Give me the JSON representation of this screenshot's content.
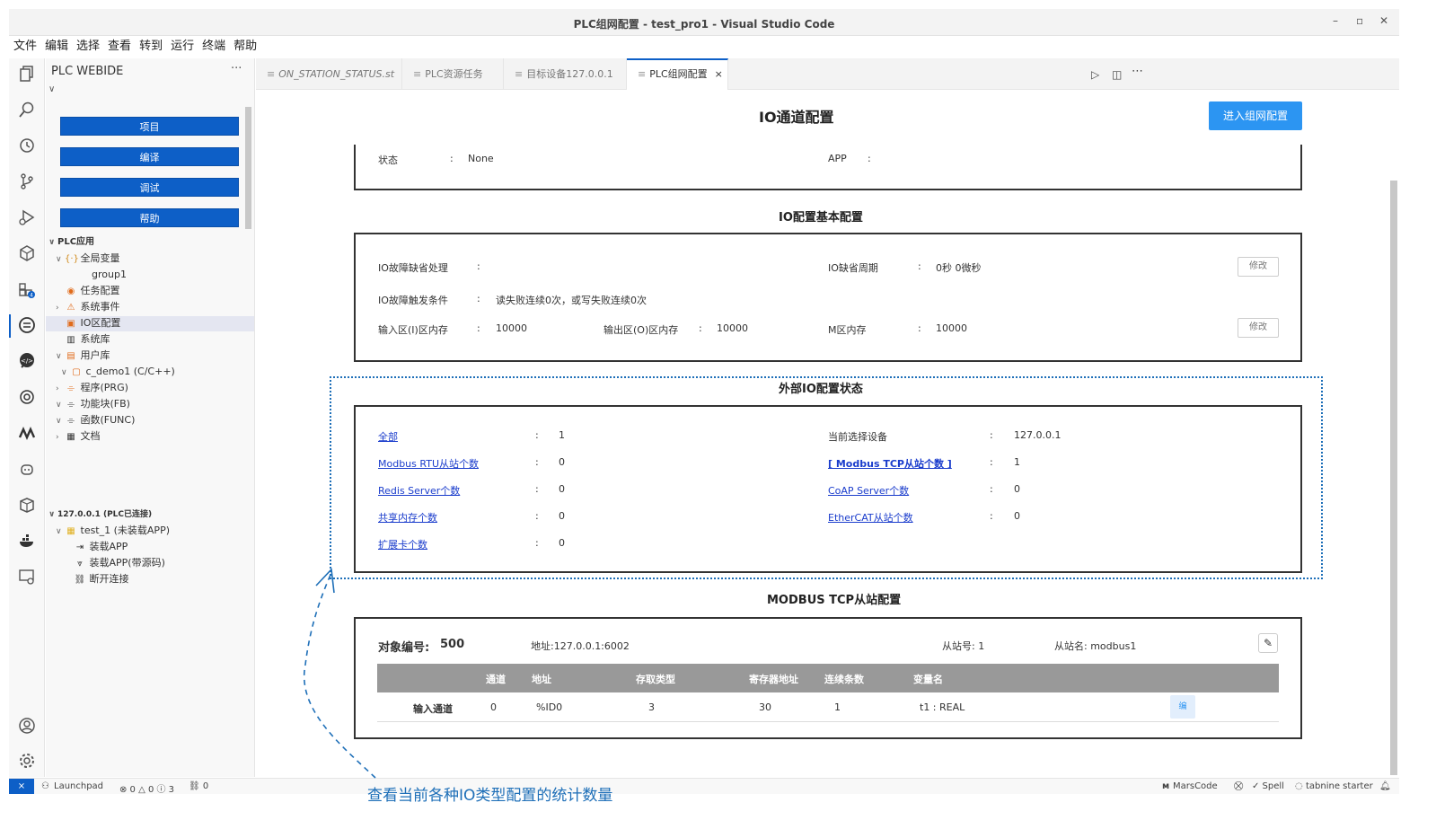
{
  "window": {
    "title": "PLC组网配置 - test_pro1 - Visual Studio Code"
  },
  "menu": [
    "文件",
    "编辑",
    "选择",
    "查看",
    "转到",
    "运行",
    "终端",
    "帮助"
  ],
  "sidebar": {
    "title": "PLC WEBIDE",
    "more": "···",
    "buttons": [
      "项目",
      "编译",
      "调试",
      "帮助"
    ],
    "tree": {
      "plc_app": "PLC应用",
      "global_vars": "全局变量",
      "group1": "group1",
      "task_config": "任务配置",
      "sys_events": "系统事件",
      "io_config": "IO区配置",
      "sys_lib": "系统库",
      "user_lib": "用户库",
      "c_demo": "c_demo1 (C/C++)",
      "prg": "程序(PRG)",
      "fb": "功能块(FB)",
      "func": "函数(FUNC)",
      "docs": "文档",
      "conn": "127.0.0.1 (PLC已连接)",
      "test1": "test_1 (未装载APP)",
      "load_app": "装载APP",
      "load_app_src": "装载APP(带源码)",
      "disconnect": "断开连接"
    }
  },
  "tabs": [
    {
      "label": "ON_STATION_STATUS.st"
    },
    {
      "label": "PLC资源任务"
    },
    {
      "label": "目标设备127.0.0.1"
    },
    {
      "label": "PLC组网配置",
      "close": "×"
    }
  ],
  "editor": {
    "title": "IO通道配置",
    "enter_button": "进入组网配置",
    "status_row": {
      "state_label": "状态",
      "colon": ":",
      "state_value": "None",
      "app_label": "APP",
      "app_colon": ":"
    },
    "basic": {
      "title": "IO配置基本配置",
      "fault_default_label": "IO故障缺省处理",
      "default_period_label": "IO缺省周期",
      "default_period_value": "0秒 0微秒",
      "modify": "修改",
      "fault_trigger_label": "IO故障触发条件",
      "fault_trigger_value": "读失败连续0次，或写失败连续0次",
      "input_mem_label": "输入区(I)区内存",
      "input_mem_value": "10000",
      "output_mem_label": "输出区(O)区内存",
      "output_mem_value": "10000",
      "m_mem_label": "M区内存",
      "m_mem_value": "10000"
    },
    "external": {
      "title": "外部IO配置状态",
      "left": [
        {
          "label": "全部",
          "value": "1"
        },
        {
          "label": "Modbus RTU从站个数",
          "value": "0"
        },
        {
          "label": "Redis Server个数",
          "value": "0"
        },
        {
          "label": "共享内存个数",
          "value": "0"
        },
        {
          "label": "扩展卡个数",
          "value": "0"
        }
      ],
      "right": [
        {
          "label": "当前选择设备",
          "value": "127.0.0.1"
        },
        {
          "label": "[ Modbus TCP从站个数 ]",
          "value": "1"
        },
        {
          "label": "CoAP Server个数",
          "value": "0"
        },
        {
          "label": "EtherCAT从站个数",
          "value": "0"
        }
      ]
    },
    "modbus": {
      "title": "MODBUS TCP从站配置",
      "obj_label": "对象编号:",
      "obj_value": "500",
      "address": "地址:127.0.0.1:6002",
      "slave_no": "从站号: 1",
      "slave_name": "从站名: modbus1",
      "headers": [
        "通道",
        "地址",
        "存取类型",
        "寄存器地址",
        "连续条数",
        "变量名"
      ],
      "row": {
        "name": "输入通道",
        "channel": "0",
        "address": "%ID0",
        "access": "3",
        "reg": "30",
        "count": "1",
        "var": "t1 : REAL",
        "edit": "编"
      }
    }
  },
  "statusbar": {
    "remote": "⨯",
    "launchpad": "Launchpad",
    "problems": "⊗ 0 △ 0 ⓘ 3",
    "ports": "⛓ 0",
    "marscode": "MarsCode",
    "spell": "✓ Spell",
    "tabnine": "tabnine starter"
  },
  "annotation": "查看当前各种IO类型配置的统计数量"
}
